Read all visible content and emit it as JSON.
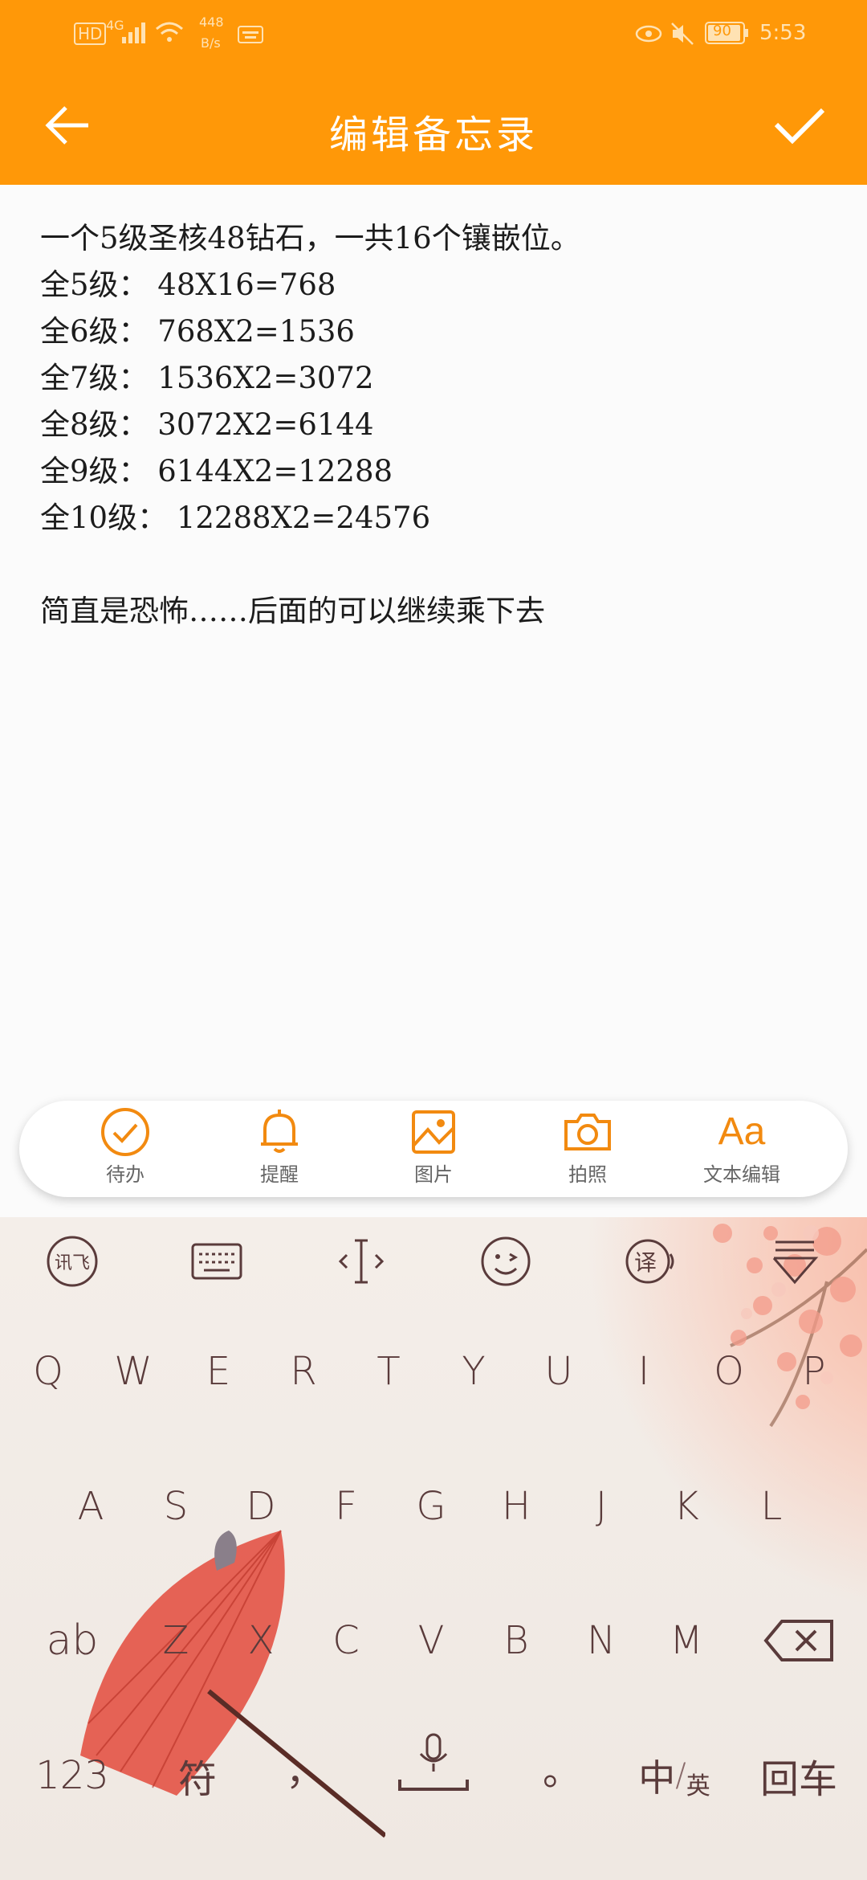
{
  "status_bar": {
    "left_hd": "HD",
    "left_net": "4G",
    "left_speed_value": "448",
    "left_speed_unit": "B/s",
    "battery": "90",
    "time": "5:53"
  },
  "header": {
    "title": "编辑备忘录",
    "back_icon": "arrow-left-icon",
    "confirm_icon": "check-icon",
    "background": "#ff9808"
  },
  "note": {
    "lines": [
      "一个5级圣核48钻石，一共16个镶嵌位。",
      "全5级： 48X16=768",
      "全6级： 768X2=1536",
      "全7级： 1536X2=3072",
      "全8级： 3072X2=6144",
      "全9级： 6144X2=12288",
      "全10级： 12288X2=24576",
      "",
      "简直是恐怖……后面的可以继续乘下去"
    ]
  },
  "toolbar": {
    "accent": "#f28a10",
    "items": [
      {
        "label": "待办",
        "icon": "check-circle-icon"
      },
      {
        "label": "提醒",
        "icon": "bell-icon"
      },
      {
        "label": "图片",
        "icon": "image-icon"
      },
      {
        "label": "拍照",
        "icon": "camera-icon"
      },
      {
        "label": "文本编辑",
        "icon_text": "Aa"
      }
    ]
  },
  "keyboard": {
    "function_row": [
      {
        "icon": "ifly-logo-icon",
        "text": "讯飞"
      },
      {
        "icon": "keyboard-icon"
      },
      {
        "icon": "cursor-icon"
      },
      {
        "icon": "emoji-wink-icon"
      },
      {
        "icon": "translate-icon",
        "text": "译"
      },
      {
        "icon": "collapse-keyboard-icon"
      }
    ],
    "row1": [
      "Q",
      "W",
      "E",
      "R",
      "T",
      "Y",
      "U",
      "I",
      "O",
      "P"
    ],
    "row2": [
      "A",
      "S",
      "D",
      "F",
      "G",
      "H",
      "J",
      "K",
      "L"
    ],
    "row3_left": "ab",
    "row3": [
      "Z",
      "X",
      "C",
      "V",
      "B",
      "N",
      "M"
    ],
    "row3_right_icon": "backspace-icon",
    "bottom": {
      "num": "123",
      "symbol": "符",
      "comma": "，",
      "space_icon": "microphone-space-icon",
      "period": "。",
      "lang_cn": "中",
      "lang_en": "英",
      "enter": "回车"
    }
  }
}
